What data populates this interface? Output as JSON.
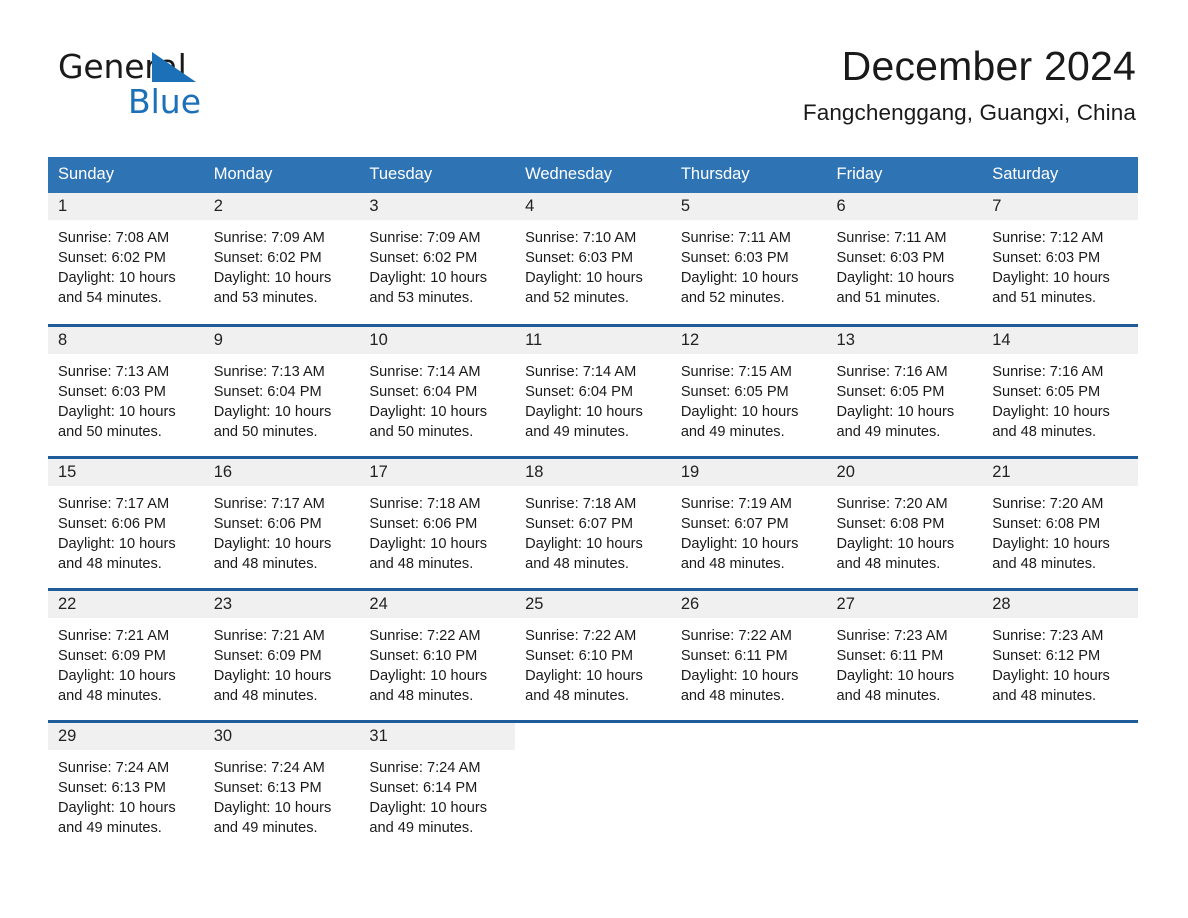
{
  "brand": {
    "word1": "General",
    "word2": "Blue",
    "triangle_color": "#1C70B8"
  },
  "header": {
    "title": "December 2024",
    "subtitle": "Fangchenggang, Guangxi, China",
    "accent_color": "#2E74B5",
    "row_divider_color": "#1F5C99",
    "daynum_band_color": "#F0F0F0"
  },
  "weekday_headers": [
    "Sunday",
    "Monday",
    "Tuesday",
    "Wednesday",
    "Thursday",
    "Friday",
    "Saturday"
  ],
  "weeks": [
    [
      {
        "day": "1",
        "sunrise": "Sunrise: 7:08 AM",
        "sunset": "Sunset: 6:02 PM",
        "daylight1": "Daylight: 10 hours",
        "daylight2": "and 54 minutes."
      },
      {
        "day": "2",
        "sunrise": "Sunrise: 7:09 AM",
        "sunset": "Sunset: 6:02 PM",
        "daylight1": "Daylight: 10 hours",
        "daylight2": "and 53 minutes."
      },
      {
        "day": "3",
        "sunrise": "Sunrise: 7:09 AM",
        "sunset": "Sunset: 6:02 PM",
        "daylight1": "Daylight: 10 hours",
        "daylight2": "and 53 minutes."
      },
      {
        "day": "4",
        "sunrise": "Sunrise: 7:10 AM",
        "sunset": "Sunset: 6:03 PM",
        "daylight1": "Daylight: 10 hours",
        "daylight2": "and 52 minutes."
      },
      {
        "day": "5",
        "sunrise": "Sunrise: 7:11 AM",
        "sunset": "Sunset: 6:03 PM",
        "daylight1": "Daylight: 10 hours",
        "daylight2": "and 52 minutes."
      },
      {
        "day": "6",
        "sunrise": "Sunrise: 7:11 AM",
        "sunset": "Sunset: 6:03 PM",
        "daylight1": "Daylight: 10 hours",
        "daylight2": "and 51 minutes."
      },
      {
        "day": "7",
        "sunrise": "Sunrise: 7:12 AM",
        "sunset": "Sunset: 6:03 PM",
        "daylight1": "Daylight: 10 hours",
        "daylight2": "and 51 minutes."
      }
    ],
    [
      {
        "day": "8",
        "sunrise": "Sunrise: 7:13 AM",
        "sunset": "Sunset: 6:03 PM",
        "daylight1": "Daylight: 10 hours",
        "daylight2": "and 50 minutes."
      },
      {
        "day": "9",
        "sunrise": "Sunrise: 7:13 AM",
        "sunset": "Sunset: 6:04 PM",
        "daylight1": "Daylight: 10 hours",
        "daylight2": "and 50 minutes."
      },
      {
        "day": "10",
        "sunrise": "Sunrise: 7:14 AM",
        "sunset": "Sunset: 6:04 PM",
        "daylight1": "Daylight: 10 hours",
        "daylight2": "and 50 minutes."
      },
      {
        "day": "11",
        "sunrise": "Sunrise: 7:14 AM",
        "sunset": "Sunset: 6:04 PM",
        "daylight1": "Daylight: 10 hours",
        "daylight2": "and 49 minutes."
      },
      {
        "day": "12",
        "sunrise": "Sunrise: 7:15 AM",
        "sunset": "Sunset: 6:05 PM",
        "daylight1": "Daylight: 10 hours",
        "daylight2": "and 49 minutes."
      },
      {
        "day": "13",
        "sunrise": "Sunrise: 7:16 AM",
        "sunset": "Sunset: 6:05 PM",
        "daylight1": "Daylight: 10 hours",
        "daylight2": "and 49 minutes."
      },
      {
        "day": "14",
        "sunrise": "Sunrise: 7:16 AM",
        "sunset": "Sunset: 6:05 PM",
        "daylight1": "Daylight: 10 hours",
        "daylight2": "and 48 minutes."
      }
    ],
    [
      {
        "day": "15",
        "sunrise": "Sunrise: 7:17 AM",
        "sunset": "Sunset: 6:06 PM",
        "daylight1": "Daylight: 10 hours",
        "daylight2": "and 48 minutes."
      },
      {
        "day": "16",
        "sunrise": "Sunrise: 7:17 AM",
        "sunset": "Sunset: 6:06 PM",
        "daylight1": "Daylight: 10 hours",
        "daylight2": "and 48 minutes."
      },
      {
        "day": "17",
        "sunrise": "Sunrise: 7:18 AM",
        "sunset": "Sunset: 6:06 PM",
        "daylight1": "Daylight: 10 hours",
        "daylight2": "and 48 minutes."
      },
      {
        "day": "18",
        "sunrise": "Sunrise: 7:18 AM",
        "sunset": "Sunset: 6:07 PM",
        "daylight1": "Daylight: 10 hours",
        "daylight2": "and 48 minutes."
      },
      {
        "day": "19",
        "sunrise": "Sunrise: 7:19 AM",
        "sunset": "Sunset: 6:07 PM",
        "daylight1": "Daylight: 10 hours",
        "daylight2": "and 48 minutes."
      },
      {
        "day": "20",
        "sunrise": "Sunrise: 7:20 AM",
        "sunset": "Sunset: 6:08 PM",
        "daylight1": "Daylight: 10 hours",
        "daylight2": "and 48 minutes."
      },
      {
        "day": "21",
        "sunrise": "Sunrise: 7:20 AM",
        "sunset": "Sunset: 6:08 PM",
        "daylight1": "Daylight: 10 hours",
        "daylight2": "and 48 minutes."
      }
    ],
    [
      {
        "day": "22",
        "sunrise": "Sunrise: 7:21 AM",
        "sunset": "Sunset: 6:09 PM",
        "daylight1": "Daylight: 10 hours",
        "daylight2": "and 48 minutes."
      },
      {
        "day": "23",
        "sunrise": "Sunrise: 7:21 AM",
        "sunset": "Sunset: 6:09 PM",
        "daylight1": "Daylight: 10 hours",
        "daylight2": "and 48 minutes."
      },
      {
        "day": "24",
        "sunrise": "Sunrise: 7:22 AM",
        "sunset": "Sunset: 6:10 PM",
        "daylight1": "Daylight: 10 hours",
        "daylight2": "and 48 minutes."
      },
      {
        "day": "25",
        "sunrise": "Sunrise: 7:22 AM",
        "sunset": "Sunset: 6:10 PM",
        "daylight1": "Daylight: 10 hours",
        "daylight2": "and 48 minutes."
      },
      {
        "day": "26",
        "sunrise": "Sunrise: 7:22 AM",
        "sunset": "Sunset: 6:11 PM",
        "daylight1": "Daylight: 10 hours",
        "daylight2": "and 48 minutes."
      },
      {
        "day": "27",
        "sunrise": "Sunrise: 7:23 AM",
        "sunset": "Sunset: 6:11 PM",
        "daylight1": "Daylight: 10 hours",
        "daylight2": "and 48 minutes."
      },
      {
        "day": "28",
        "sunrise": "Sunrise: 7:23 AM",
        "sunset": "Sunset: 6:12 PM",
        "daylight1": "Daylight: 10 hours",
        "daylight2": "and 48 minutes."
      }
    ],
    [
      {
        "day": "29",
        "sunrise": "Sunrise: 7:24 AM",
        "sunset": "Sunset: 6:13 PM",
        "daylight1": "Daylight: 10 hours",
        "daylight2": "and 49 minutes."
      },
      {
        "day": "30",
        "sunrise": "Sunrise: 7:24 AM",
        "sunset": "Sunset: 6:13 PM",
        "daylight1": "Daylight: 10 hours",
        "daylight2": "and 49 minutes."
      },
      {
        "day": "31",
        "sunrise": "Sunrise: 7:24 AM",
        "sunset": "Sunset: 6:14 PM",
        "daylight1": "Daylight: 10 hours",
        "daylight2": "and 49 minutes."
      },
      {
        "day": "",
        "sunrise": "",
        "sunset": "",
        "daylight1": "",
        "daylight2": ""
      },
      {
        "day": "",
        "sunrise": "",
        "sunset": "",
        "daylight1": "",
        "daylight2": ""
      },
      {
        "day": "",
        "sunrise": "",
        "sunset": "",
        "daylight1": "",
        "daylight2": ""
      },
      {
        "day": "",
        "sunrise": "",
        "sunset": "",
        "daylight1": "",
        "daylight2": ""
      }
    ]
  ]
}
